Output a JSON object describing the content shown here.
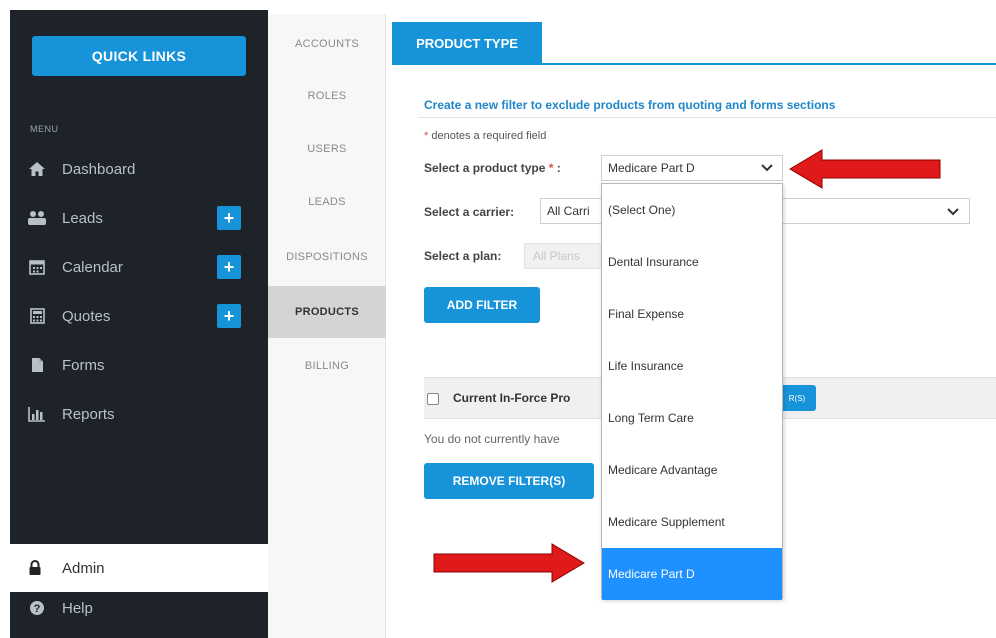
{
  "sidebar": {
    "quick_links": "QUICK LINKS",
    "menu_label": "MENU",
    "items": [
      {
        "label": "Dashboard",
        "icon": "home-icon"
      },
      {
        "label": "Leads",
        "icon": "users-icon"
      },
      {
        "label": "Calendar",
        "icon": "calendar-icon"
      },
      {
        "label": "Quotes",
        "icon": "calculator-icon"
      },
      {
        "label": "Forms",
        "icon": "document-icon"
      },
      {
        "label": "Reports",
        "icon": "bar-chart-icon"
      }
    ],
    "admin_label": "Admin",
    "help_label": "Help"
  },
  "subnav": {
    "items": [
      "ACCOUNTS",
      "ROLES",
      "USERS",
      "LEADS",
      "DISPOSITIONS",
      "PRODUCTS",
      "BILLING"
    ],
    "active": "PRODUCTS"
  },
  "main": {
    "tab": "PRODUCT TYPE",
    "headline": "Create a new filter to exclude products from quoting and forms sections",
    "required_note": "denotes a required field",
    "product_type_label": "Select a product type",
    "product_type_value": "Medicare Part D",
    "carrier_label": "Select a carrier:",
    "carrier_value": "All Carri",
    "plan_label": "Select a plan:",
    "plan_value": "All Plans",
    "add_filter": "ADD FILTER",
    "inforce_label": "Current In-Force Pro",
    "inforce_button": "R(S)",
    "no_products_text": "You do not currently have",
    "remove_filters": "REMOVE FILTER(S)"
  },
  "dropdown": {
    "options": [
      "(Select One)",
      "Dental Insurance",
      "Final Expense",
      "Life Insurance",
      "Long Term Care",
      "Medicare Advantage",
      "Medicare Supplement",
      "Medicare Part D"
    ],
    "selected": "Medicare Part D"
  },
  "colors": {
    "accent": "#1793d9",
    "sidebar_bg": "#1e2329",
    "selected_option": "#1e90ff",
    "annotation_arrow": "#e0191a"
  }
}
